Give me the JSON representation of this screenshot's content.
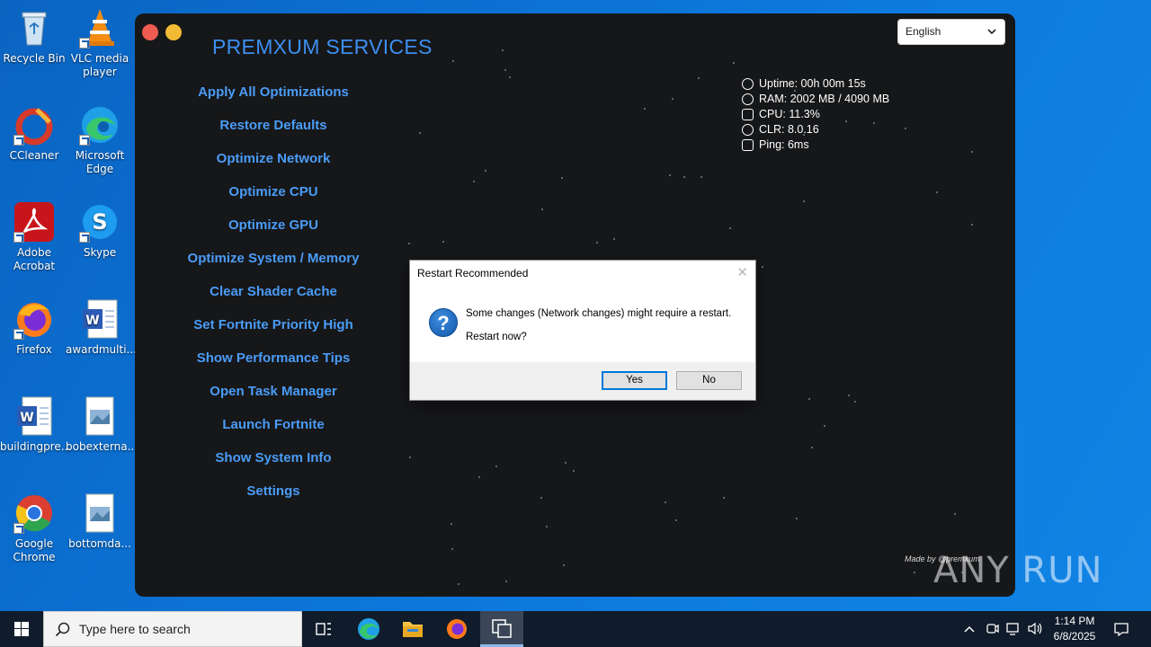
{
  "desktop": {
    "icons": [
      {
        "label": "Recycle Bin"
      },
      {
        "label": "VLC media player"
      },
      {
        "label": "CCleaner"
      },
      {
        "label": "Microsoft Edge"
      },
      {
        "label": "Adobe Acrobat"
      },
      {
        "label": "Skype"
      },
      {
        "label": "Firefox"
      },
      {
        "label": "awardmulti..."
      },
      {
        "label": "buildingpre..."
      },
      {
        "label": "bobexterna..."
      },
      {
        "label": "Google Chrome"
      },
      {
        "label": "bottomda..."
      }
    ]
  },
  "app": {
    "title": "PREMXUM SERVICES",
    "language": "English",
    "menu": [
      {
        "label": "Apply All Optimizations"
      },
      {
        "label": "Restore Defaults"
      },
      {
        "label": "Optimize Network"
      },
      {
        "label": "Optimize CPU"
      },
      {
        "label": "Optimize GPU"
      },
      {
        "label": "Optimize System / Memory"
      },
      {
        "label": "Clear Shader Cache"
      },
      {
        "label": "Set Fortnite Priority High"
      },
      {
        "label": "Show Performance Tips"
      },
      {
        "label": "Open Task Manager"
      },
      {
        "label": "Launch Fortnite"
      },
      {
        "label": "Show System Info"
      },
      {
        "label": "Settings"
      }
    ],
    "stats": {
      "uptime": "Uptime: 00h 00m 15s",
      "ram": "RAM: 2002 MB / 4090 MB",
      "cpu": "CPU: 11.3%",
      "clr": "CLR: 8.0.16",
      "ping": "Ping: 6ms"
    },
    "made_by": "Made by @premxum",
    "colors": {
      "accent": "#3c8ff0",
      "menu_text": "#4a9cf7",
      "background": "#161719"
    }
  },
  "dialog": {
    "title": "Restart Recommended",
    "message": "Some changes (Network changes) might require a restart.",
    "question": "Restart now?",
    "yes_label": "Yes",
    "no_label": "No",
    "icon": "question-icon"
  },
  "taskbar": {
    "search_placeholder": "Type here to search",
    "time": "1:14 PM",
    "date": "6/8/2025"
  },
  "watermark": "ANY RUN"
}
